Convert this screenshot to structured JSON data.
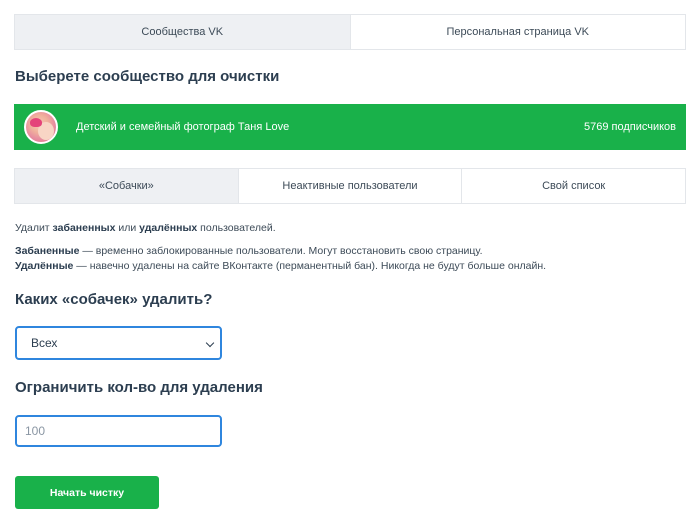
{
  "top_tabs": [
    {
      "label": "Сообщества VK",
      "active": true
    },
    {
      "label": "Персональная страница VK",
      "active": false
    }
  ],
  "community_heading": "Выберете сообщество для очистки",
  "community": {
    "name": "Детский и семейный фотограф Таня Love",
    "subscribers": "5769 подписчиков"
  },
  "sub_tabs": [
    {
      "label": "«Собачки»",
      "active": true
    },
    {
      "label": "Неактивные пользователи",
      "active": false
    },
    {
      "label": "Свой список",
      "active": false
    }
  ],
  "description": {
    "line1_prefix": "Удалит ",
    "line1_bold1": "забаненных",
    "line1_mid": " или ",
    "line1_bold2": "удалённых",
    "line1_suffix": " пользователей.",
    "banned_term": "Забаненные",
    "banned_text": " — временно заблокированные пользователи. Могут восстановить свою страницу.",
    "deleted_term": "Удалённые",
    "deleted_text": " — навечно удалены на сайте ВКонтакте (перманентный бан). Никогда не будут больше онлайн."
  },
  "dogs_heading": "Каких «собачек» удалить?",
  "dogs_select": {
    "value": "Всех"
  },
  "limit_heading": "Ограничить кол-во для удаления",
  "limit_input": {
    "placeholder": "100"
  },
  "start_button": "Начать чистку",
  "colors": {
    "accent_green": "#19b14a",
    "focus_blue": "#2f86de"
  }
}
